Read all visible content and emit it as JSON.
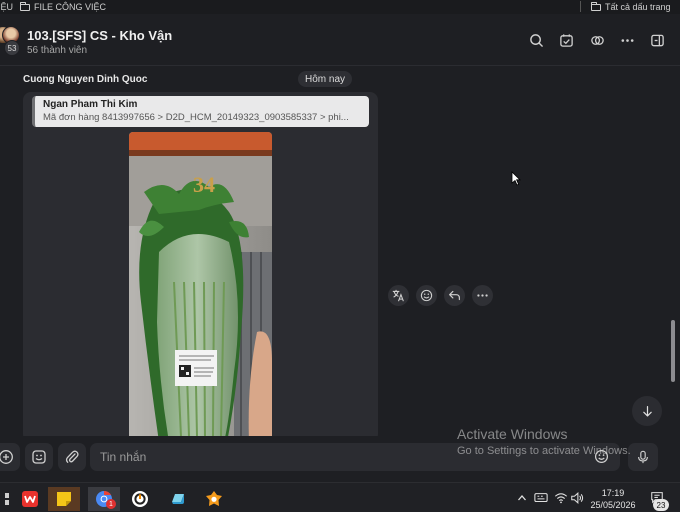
{
  "bookmarks": {
    "left_partial": "IỆU",
    "work_files": "FILE CÔNG VIỆC",
    "all_bookmarks": "Tất cả dấu trang"
  },
  "header": {
    "title": "103.[SFS] CS - Kho Vận",
    "subtitle": "56 thành viên",
    "avatar_count": "53"
  },
  "message": {
    "sender": "Cuong Nguyen Dinh Quoc",
    "date_badge": "Hôm nay",
    "quote_author": "Ngan Pham Thi Kim",
    "quote_text": "Mã đơn hàng 8413997656 > D2D_HCM_20149323_0903585337 > phi...",
    "photo": {
      "sign_text": "34",
      "label_lines": [
        "R...",
        "..."
      ]
    }
  },
  "composer": {
    "placeholder": "Tin nhắn"
  },
  "watermark": {
    "title": "Activate Windows",
    "subtitle": "Go to Settings to activate Windows."
  },
  "taskbar": {
    "chrome_badge": "1",
    "time": "17:19",
    "date": "25/05/2026",
    "notification_count": "23"
  },
  "colors": {
    "background": "#1e1f23",
    "bubble": "#2b2c31",
    "quote_bg": "#e9e9ea",
    "accent_orange": "#f5a623"
  },
  "icons": [
    "folder-icon",
    "search-icon",
    "checkbox-calendar-icon",
    "link-icon",
    "more-icon",
    "sidebar-icon",
    "translate-icon",
    "emoji-icon",
    "reply-icon",
    "arrow-down-icon",
    "plus-circle-icon",
    "sticker-icon",
    "paperclip-icon",
    "mic-icon",
    "wps-icon",
    "sticky-notes-icon",
    "chrome-icon",
    "beeper-icon",
    "onedrive-icon",
    "grafana-icon",
    "chevron-up-icon",
    "input-method-icon",
    "wifi-icon",
    "volume-icon",
    "notification-icon"
  ]
}
